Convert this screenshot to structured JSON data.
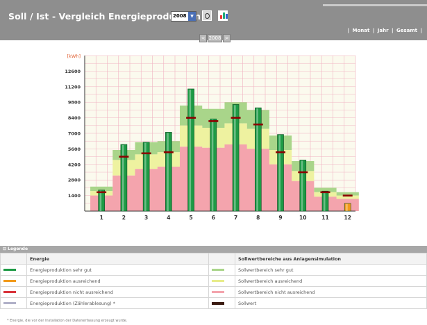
{
  "header": {
    "title": "Soll / Ist - Vergleich Energieproduktion",
    "year_value": "2008",
    "nav_links": [
      "Monat",
      "Jahr",
      "Gesamt"
    ],
    "year_nav_label": "2008",
    "prev_symbol": "<",
    "next_symbol": ">"
  },
  "chart_data": {
    "type": "bar",
    "ylabel": "[kWh]",
    "yticks": [
      1400,
      2800,
      4200,
      5600,
      7000,
      8400,
      9800,
      11200,
      12600
    ],
    "ylim": [
      0,
      14000
    ],
    "categories": [
      "1",
      "2",
      "3",
      "4",
      "5",
      "6",
      "7",
      "8",
      "9",
      "10",
      "11",
      "12"
    ],
    "grid": true,
    "series": [
      {
        "values": [
          1900,
          6000,
          6200,
          7100,
          11000,
          8300,
          9600,
          9300,
          6900,
          4600,
          1800,
          700
        ]
      }
    ],
    "bar_colors": [
      "green",
      "green",
      "green",
      "green",
      "green",
      "green",
      "green",
      "green",
      "green",
      "green",
      "green",
      "orange"
    ],
    "target_values": [
      1700,
      4900,
      5200,
      5300,
      8400,
      8100,
      8400,
      7800,
      5300,
      3500,
      1700,
      1400
    ],
    "bands": {
      "red_top": [
        1400,
        3200,
        3800,
        4000,
        5800,
        5700,
        6000,
        5600,
        4200,
        2700,
        1300,
        1100
      ],
      "yellow_top": [
        1800,
        4600,
        5100,
        5300,
        7700,
        7500,
        7900,
        7400,
        5500,
        3600,
        1700,
        1400
      ],
      "green_top": [
        2200,
        5500,
        6200,
        6300,
        9500,
        9200,
        9800,
        9100,
        6800,
        4500,
        2100,
        1700
      ]
    },
    "colors": {
      "bar_green": "#1e9a45",
      "bar_orange": "#f29a1b",
      "band_red": "#f4a4ad",
      "band_yellow": "#eef2a0",
      "band_green": "#a9d58a",
      "target": "#8b0000",
      "grid": "#f1b3c2",
      "plot_bg": "#fbfaee"
    }
  },
  "legend": {
    "title": "Legende",
    "col1_header": "Energie",
    "col2_header": "Sollwertbereiche aus Anlagensimulation",
    "rows": [
      {
        "left": "Energieproduktion sehr gut",
        "right": "Sollwertbereich sehr gut",
        "left_color": "#1e9a45",
        "right_color": "#a9d58a"
      },
      {
        "left": "Energieproduktion ausreichend",
        "right": "Sollwertbereich ausreichend",
        "left_color": "#f29a1b",
        "right_color": "#e8ec8a"
      },
      {
        "left": "Energieproduktion nicht ausreichend",
        "right": "Sollwertbereich nicht ausreichend",
        "left_color": "#d9343b",
        "right_color": "#f4a4ad"
      },
      {
        "left": "Energieproduktion (Zählerablesung) *",
        "right": "Sollwert",
        "left_color": "#b0b0c8",
        "right_color": "#3a1a10"
      }
    ],
    "footnote": "* Energie, die vor der Installation der Datenerfassung erzeugt wurde."
  }
}
